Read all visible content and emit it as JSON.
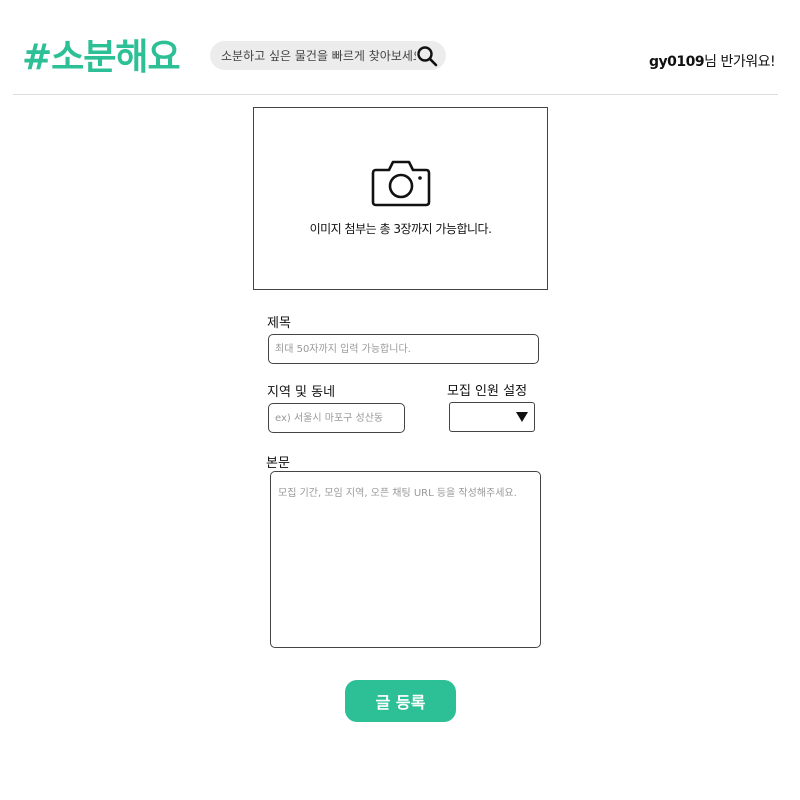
{
  "header": {
    "logo": "#소분해요",
    "search": {
      "placeholder": "소분하고 싶은 물건을 빠르게 찾아보세요",
      "icon": "search-icon"
    },
    "greeting": {
      "user_id": "gy0109",
      "suffix": "님 반가워요!"
    }
  },
  "upload": {
    "icon": "camera-icon",
    "text": "이미지 첨부는 총 3장까지 가능합니다."
  },
  "form": {
    "title_label": "제목",
    "title_placeholder": "최대 50자까지 입력 가능합니다.",
    "region_label": "지역 및 동네",
    "region_placeholder": "ex) 서울시 마포구 성산동",
    "members_label": "모집 인원 설정",
    "members_value": "",
    "body_label": "본문",
    "body_placeholder": "모집 기간, 모임 지역, 오픈 채팅 URL 등을 작성해주세요.",
    "submit_label": "글 등록"
  },
  "colors": {
    "accent": "#2dbf95"
  }
}
